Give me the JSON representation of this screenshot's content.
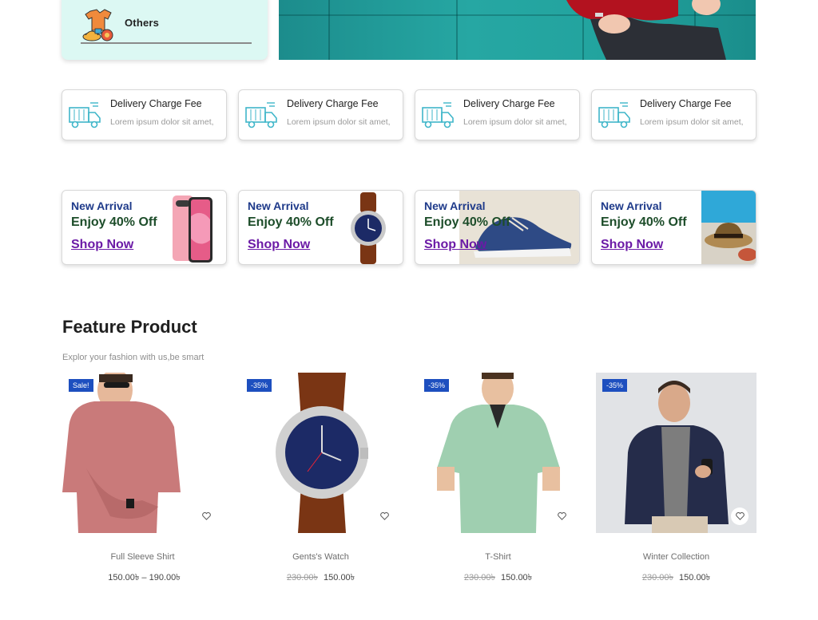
{
  "category": {
    "label": "Others",
    "icon": "clothes-icon"
  },
  "delivery_cards": [
    {
      "title": "Delivery Charge Fee",
      "text": "Lorem ipsum dolor sit amet,",
      "icon": "truck-icon"
    },
    {
      "title": "Delivery Charge Fee",
      "text": "Lorem ipsum dolor sit amet,",
      "icon": "truck-icon"
    },
    {
      "title": "Delivery Charge Fee",
      "text": "Lorem ipsum dolor sit amet,",
      "icon": "truck-icon"
    },
    {
      "title": "Delivery Charge Fee",
      "text": "Lorem ipsum dolor sit amet,",
      "icon": "truck-icon"
    }
  ],
  "promos": [
    {
      "tag": "New Arrival",
      "offer": "Enjoy 40% Off",
      "link": "Shop Now",
      "image": "phone-image"
    },
    {
      "tag": "New Arrival",
      "offer": "Enjoy 40% Off",
      "link": "Shop Now",
      "image": "watch-image"
    },
    {
      "tag": "New Arrival",
      "offer": "Enjoy 40% Off",
      "link": "Shop Now",
      "image": "sneaker-image"
    },
    {
      "tag": "New Arrival",
      "offer": "Enjoy 40% Off",
      "link": "Shop Now",
      "image": "hat-image"
    }
  ],
  "feature": {
    "title": "Feature Product",
    "subtitle": "Explor your fashion with us,be smart"
  },
  "products": [
    {
      "name": "Full Sleeve Shirt",
      "badge": "Sale!",
      "old_price": "",
      "price": "150.00৳ – 190.00৳"
    },
    {
      "name": "Gents's Watch",
      "badge": "-35%",
      "old_price": "230.00৳",
      "price": "150.00৳"
    },
    {
      "name": "T-Shirt",
      "badge": "-35%",
      "old_price": "230.00৳",
      "price": "150.00৳"
    },
    {
      "name": "Winter Collection",
      "badge": "-35%",
      "old_price": "230.00৳",
      "price": "150.00৳"
    }
  ],
  "colors": {
    "accent_blue": "#1d4fbf",
    "promo_tag": "#1e3a8a",
    "promo_offer": "#1d4d2a",
    "promo_link": "#6b1aa6",
    "category_bg": "#dcf8f3",
    "truck_icon": "#3fb6c9"
  }
}
